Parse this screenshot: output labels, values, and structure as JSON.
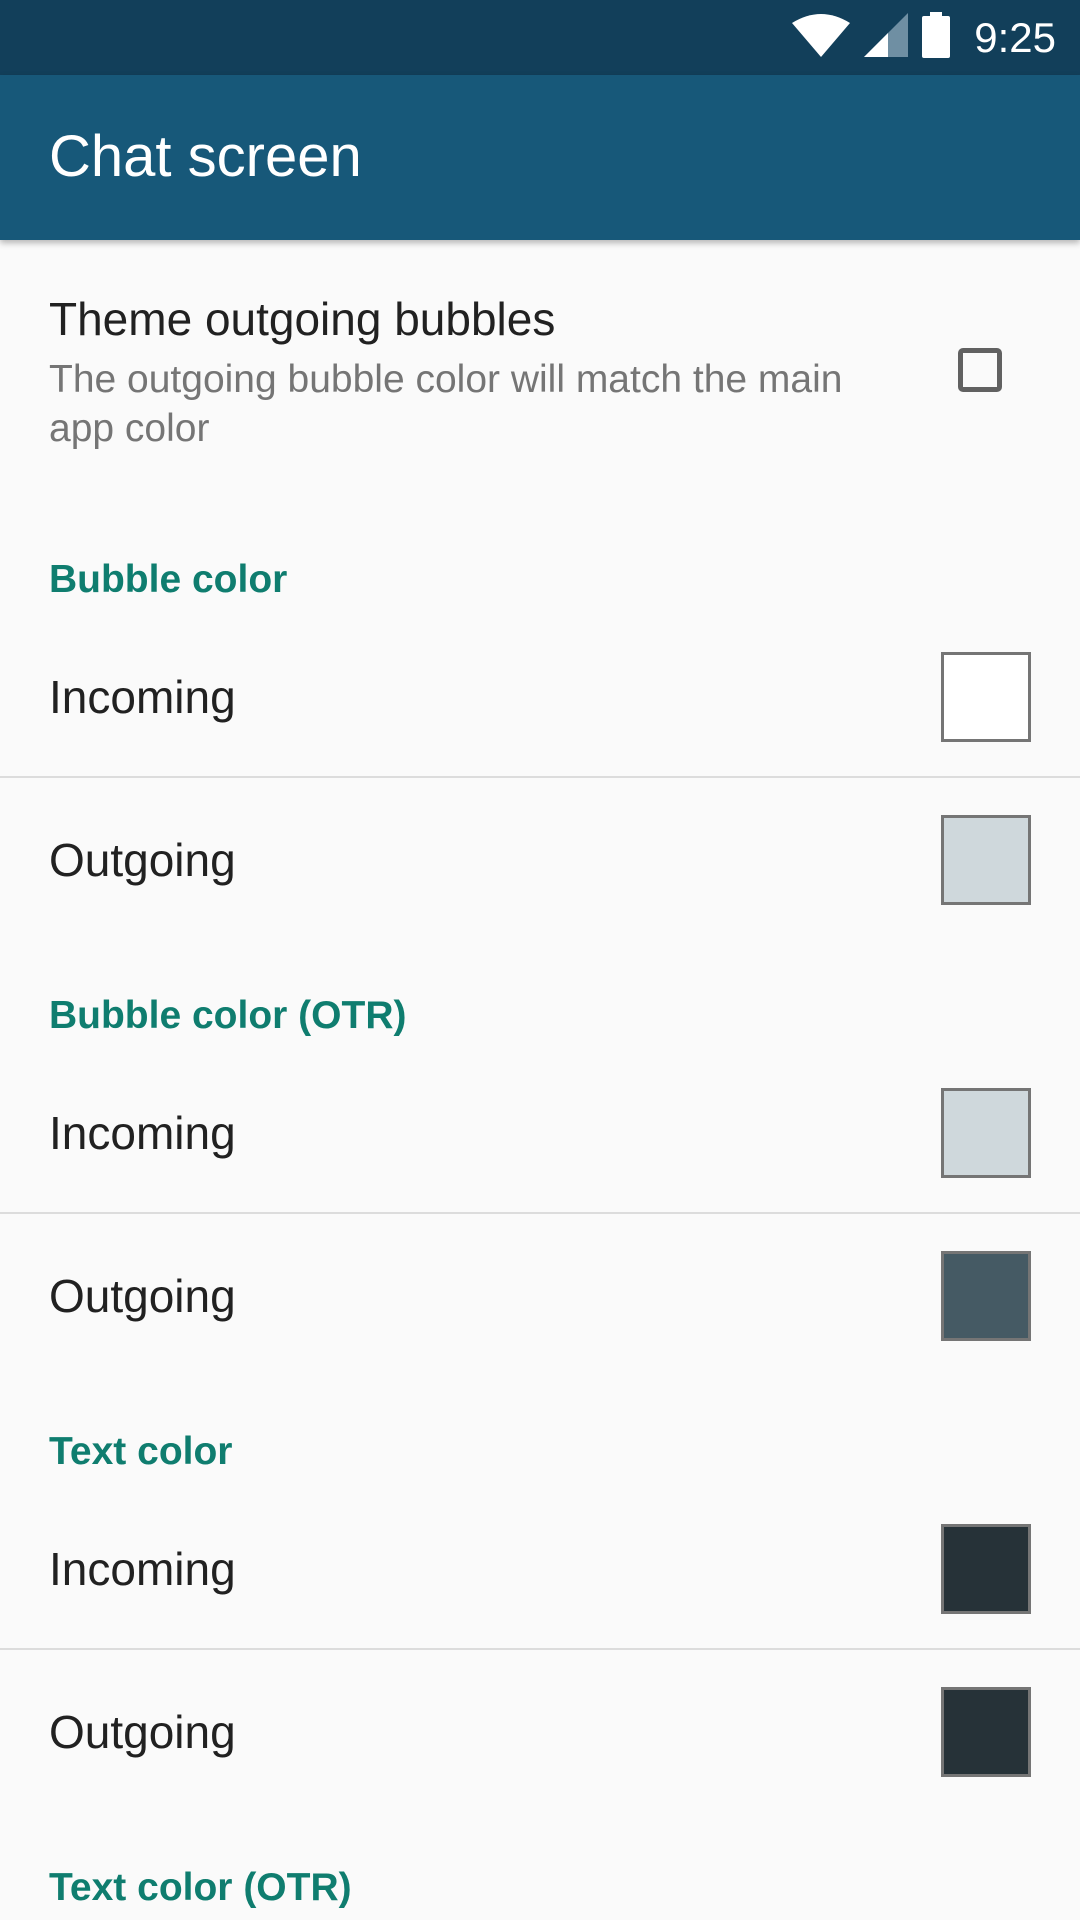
{
  "status_bar": {
    "time": "9:25",
    "icons": [
      "wifi-icon",
      "signal-icon",
      "battery-icon"
    ]
  },
  "app_bar": {
    "title": "Chat screen"
  },
  "theme_bubbles": {
    "title": "Theme outgoing bubbles",
    "summary": "The outgoing bubble color will match the main app color",
    "checked": false
  },
  "sections": [
    {
      "title": "Bubble color",
      "items": [
        {
          "label": "Incoming",
          "color": "#ffffff"
        },
        {
          "label": "Outgoing",
          "color": "#cfd8dc"
        }
      ]
    },
    {
      "title": "Bubble color (OTR)",
      "items": [
        {
          "label": "Incoming",
          "color": "#cfd8dc"
        },
        {
          "label": "Outgoing",
          "color": "#455a64"
        }
      ]
    },
    {
      "title": "Text color",
      "items": [
        {
          "label": "Incoming",
          "color": "#263238"
        },
        {
          "label": "Outgoing",
          "color": "#263238"
        }
      ]
    },
    {
      "title": "Text color (OTR)",
      "items": []
    }
  ],
  "colors": {
    "status_bar": "#123f5a",
    "app_bar": "#175879",
    "category_accent": "#0f7d6f"
  }
}
